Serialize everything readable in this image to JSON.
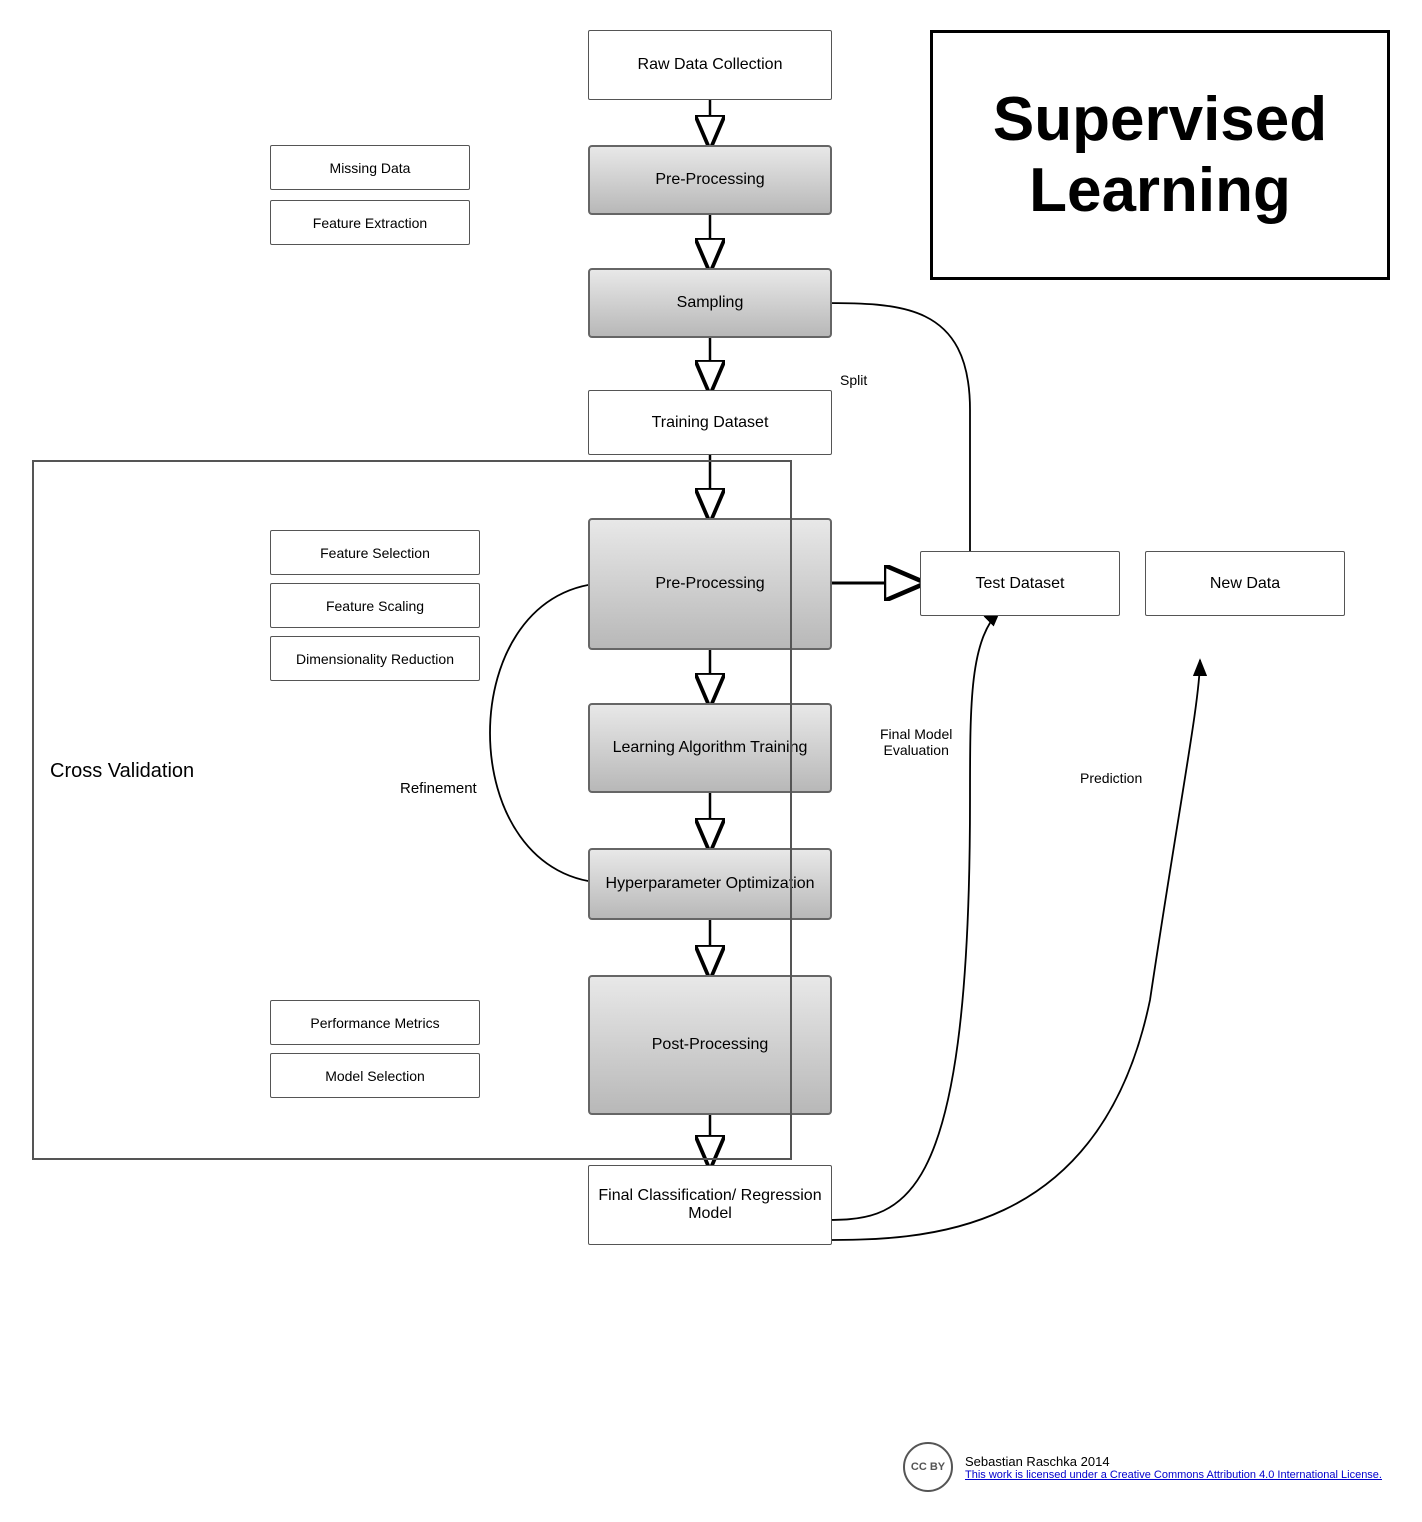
{
  "title": "Supervised Learning",
  "nodes": {
    "raw_data": "Raw Data Collection",
    "pre_processing_top": "Pre-Processing",
    "missing_data": "Missing Data",
    "feature_extraction": "Feature Extraction",
    "sampling": "Sampling",
    "training_dataset": "Training Dataset",
    "pre_processing_mid": "Pre-Processing",
    "feature_selection": "Feature Selection",
    "feature_scaling": "Feature Scaling",
    "dimensionality_reduction": "Dimensionality Reduction",
    "learning_algorithm": "Learning Algorithm Training",
    "hyperparameter": "Hyperparameter Optimization",
    "post_processing": "Post-Processing",
    "performance_metrics": "Performance Metrics",
    "model_selection": "Model Selection",
    "final_classification": "Final Classification/ Regression Model",
    "test_dataset": "Test Dataset",
    "new_data": "New Data",
    "cross_validation": "Cross Validation"
  },
  "labels": {
    "split": "Split",
    "refinement": "Refinement",
    "final_model_evaluation": "Final Model\nEvaluation",
    "prediction": "Prediction",
    "attribution": "Sebastian Raschka 2014",
    "license": "This work is licensed under a Creative Commons Attribution 4.0 International License."
  }
}
